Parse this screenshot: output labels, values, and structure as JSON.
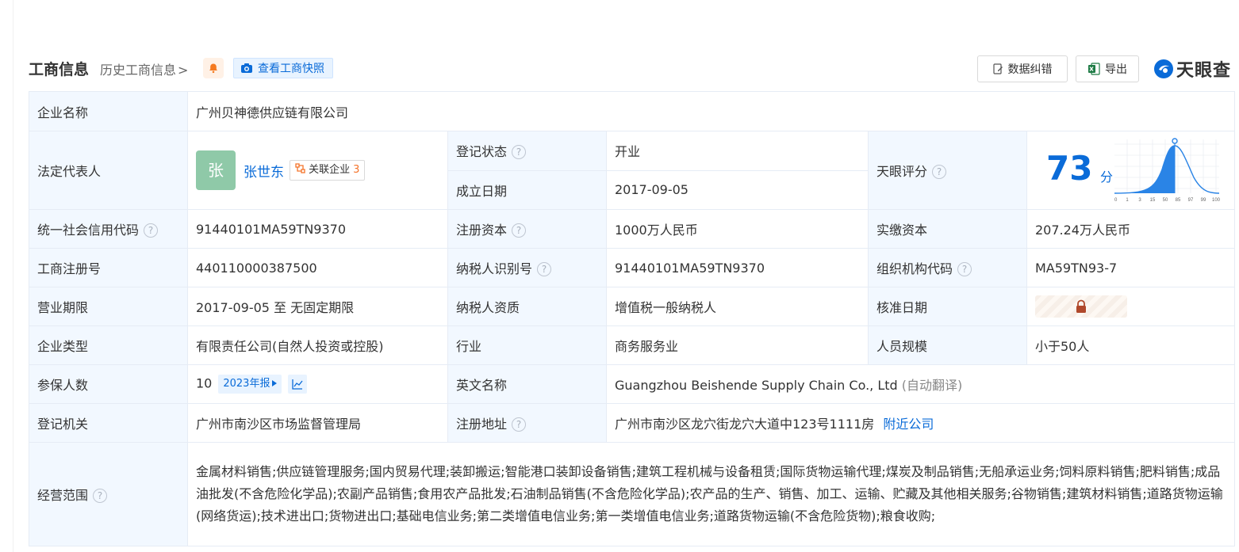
{
  "header": {
    "title": "工商信息",
    "history_link": "历史工商信息",
    "history_chevron": ">",
    "snapshot_button": "查看工商快照",
    "correct_button": "数据纠错",
    "export_button": "导出",
    "brand": "天眼查"
  },
  "company": {
    "name_label": "企业名称",
    "name": "广州贝神德供应链有限公司",
    "legal_rep_label": "法定代表人",
    "legal_rep_avatar": "张",
    "legal_rep_name": "张世东",
    "related_label": "关联企业",
    "related_count": "3",
    "reg_status_label": "登记状态",
    "reg_status": "开业",
    "founded_label": "成立日期",
    "founded": "2017-09-05",
    "score_label": "天眼评分",
    "score": "73",
    "score_unit": "分",
    "score_axis": [
      "0",
      "1",
      "3",
      "15",
      "50",
      "85",
      "97",
      "99",
      "100"
    ],
    "credit_code_label": "统一社会信用代码",
    "credit_code": "91440101MA59TN9370",
    "reg_capital_label": "注册资本",
    "reg_capital": "1000万人民币",
    "paid_capital_label": "实缴资本",
    "paid_capital": "207.24万人民币",
    "biz_reg_no_label": "工商注册号",
    "biz_reg_no": "440110000387500",
    "taxpayer_id_label": "纳税人识别号",
    "taxpayer_id": "91440101MA59TN9370",
    "org_code_label": "组织机构代码",
    "org_code": "MA59TN93-7",
    "term_label": "营业期限",
    "term": "2017-09-05 至 无固定期限",
    "tax_qual_label": "纳税人资质",
    "tax_qual": "增值税一般纳税人",
    "approval_date_label": "核准日期",
    "type_label": "企业类型",
    "type": "有限责任公司(自然人投资或控股)",
    "industry_label": "行业",
    "industry": "商务服务业",
    "staff_size_label": "人员规模",
    "staff_size": "小于50人",
    "insured_label": "参保人数",
    "insured": "10",
    "insured_year": "2023年报",
    "english_name_label": "英文名称",
    "english_name": "Guangzhou Beishende Supply Chain Co., Ltd",
    "english_name_note": "(自动翻译)",
    "authority_label": "登记机关",
    "authority": "广州市南沙区市场监督管理局",
    "address_label": "注册地址",
    "address": "广州市南沙区龙穴街龙穴大道中123号1111房",
    "nearby_link": "附近公司",
    "scope_label": "经营范围",
    "scope": "金属材料销售;供应链管理服务;国内贸易代理;装卸搬运;智能港口装卸设备销售;建筑工程机械与设备租赁;国际货物运输代理;煤炭及制品销售;无船承运业务;饲料原料销售;肥料销售;成品油批发(不含危险化学品);农副产品销售;食用农产品批发;石油制品销售(不含危险化学品);农产品的生产、销售、加工、运输、贮藏及其他相关服务;谷物销售;建筑材料销售;道路货物运输(网络货运);技术进出口;货物进出口;基础电信业务;第二类增值电信业务;第一类增值电信业务;道路货物运输(不含危险货物);粮食收购;"
  },
  "colors": {
    "accent": "#0a6bd8",
    "label_bg": "#f2f8ff",
    "status_green": "#1a9c4b",
    "related_count": "#f5732a"
  }
}
